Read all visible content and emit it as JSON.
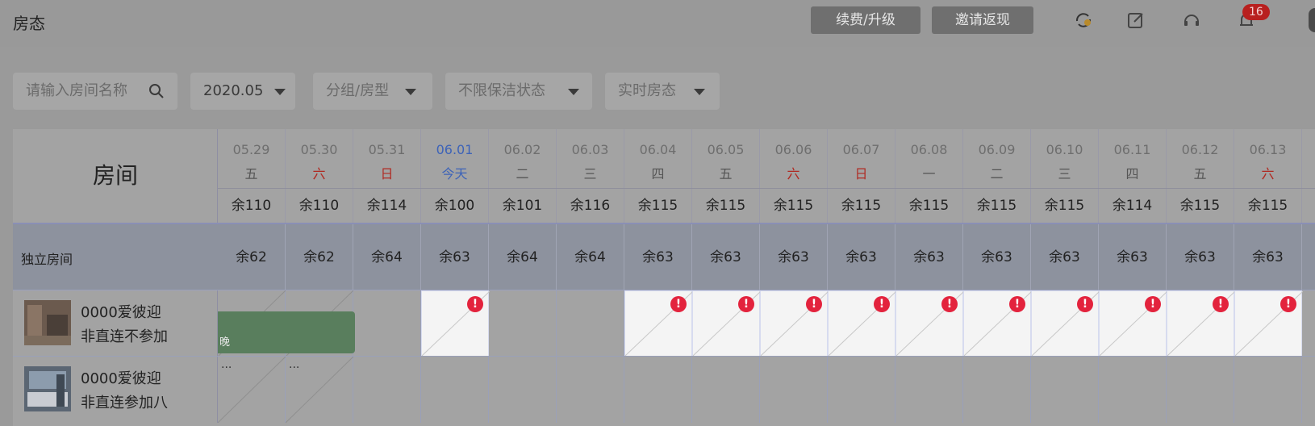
{
  "header": {
    "title": "房态",
    "renew_label": "续费/升级",
    "invite_label": "邀请返现",
    "notification_count": "16",
    "icons": [
      "sync-icon",
      "edit-icon",
      "headset-icon",
      "bell-icon",
      "avatar"
    ]
  },
  "filters": {
    "search_placeholder": "请输入房间名称",
    "date": "2020.05",
    "group": "分组/房型",
    "cleaning": "不限保洁状态",
    "status": "实时房态"
  },
  "grid": {
    "room_header": "房间",
    "dates": [
      {
        "date": "05.29",
        "weekday": "五",
        "remaining": "余110"
      },
      {
        "date": "05.30",
        "weekday": "六",
        "remaining": "余110"
      },
      {
        "date": "05.31",
        "weekday": "日",
        "remaining": "余114"
      },
      {
        "date": "06.01",
        "weekday": "今天",
        "remaining": "余100"
      },
      {
        "date": "06.02",
        "weekday": "二",
        "remaining": "余101"
      },
      {
        "date": "06.03",
        "weekday": "三",
        "remaining": "余116"
      },
      {
        "date": "06.04",
        "weekday": "四",
        "remaining": "余115"
      },
      {
        "date": "06.05",
        "weekday": "五",
        "remaining": "余115"
      },
      {
        "date": "06.06",
        "weekday": "六",
        "remaining": "余115"
      },
      {
        "date": "06.07",
        "weekday": "日",
        "remaining": "余115"
      },
      {
        "date": "06.08",
        "weekday": "一",
        "remaining": "余115"
      },
      {
        "date": "06.09",
        "weekday": "二",
        "remaining": "余115"
      },
      {
        "date": "06.10",
        "weekday": "三",
        "remaining": "余115"
      },
      {
        "date": "06.11",
        "weekday": "四",
        "remaining": "余114"
      },
      {
        "date": "06.12",
        "weekday": "五",
        "remaining": "余115"
      },
      {
        "date": "06.13",
        "weekday": "六",
        "remaining": "余115"
      }
    ],
    "group": {
      "name": "独立房间",
      "remaining": [
        "余62",
        "余62",
        "余64",
        "余63",
        "余64",
        "余64",
        "余63",
        "余63",
        "余63",
        "余63",
        "余63",
        "余63",
        "余63",
        "余63",
        "余63",
        "余63"
      ]
    },
    "rooms": [
      {
        "line1": "0000爱彼迎",
        "line2": "非直连不参加",
        "order_text": "晚",
        "dots": "..."
      },
      {
        "line1": "0000爱彼迎",
        "line2": "非直连参加八",
        "dots": "..."
      }
    ],
    "alert_symbol": "!"
  },
  "colors": {
    "order_block": "#597e5d",
    "alert": "#e3233d",
    "today": "#3d63b8",
    "weekend": "#b02a22"
  }
}
